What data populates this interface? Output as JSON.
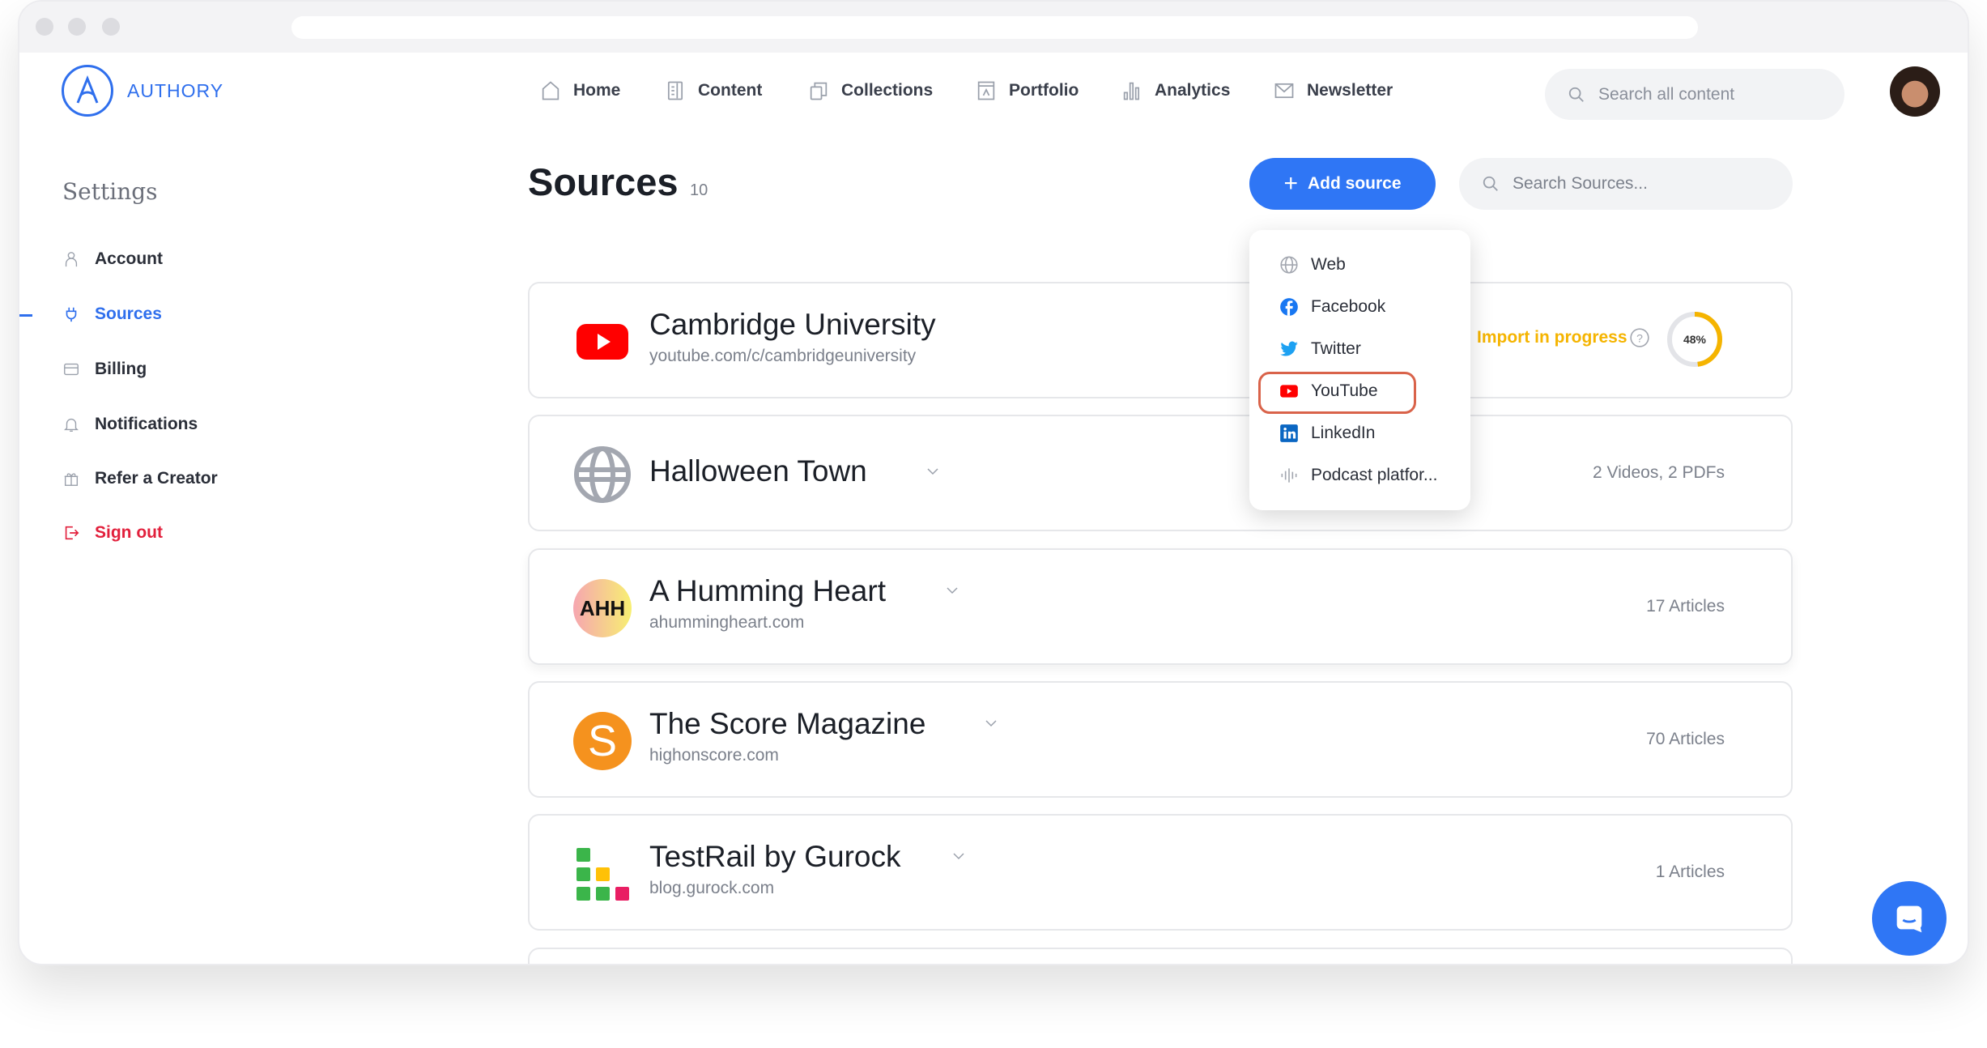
{
  "nav": {
    "brand": "AUTHORY",
    "items": [
      {
        "label": "Home",
        "icon": "home-icon"
      },
      {
        "label": "Content",
        "icon": "content-icon"
      },
      {
        "label": "Collections",
        "icon": "collections-icon"
      },
      {
        "label": "Portfolio",
        "icon": "portfolio-icon"
      },
      {
        "label": "Analytics",
        "icon": "analytics-icon"
      },
      {
        "label": "Newsletter",
        "icon": "newsletter-icon"
      }
    ],
    "search_placeholder": "Search all content"
  },
  "sidebar": {
    "heading": "Settings",
    "items": [
      {
        "label": "Account",
        "icon": "user-icon"
      },
      {
        "label": "Sources",
        "icon": "plug-icon",
        "active": true
      },
      {
        "label": "Billing",
        "icon": "card-icon"
      },
      {
        "label": "Notifications",
        "icon": "bell-icon"
      },
      {
        "label": "Refer a Creator",
        "icon": "gift-icon"
      },
      {
        "label": "Sign out",
        "icon": "sign-out-icon"
      }
    ]
  },
  "main": {
    "title": "Sources",
    "count": "10",
    "add_label": "Add source",
    "search_placeholder": "Search Sources...",
    "sources": [
      {
        "name": "Cambridge University",
        "url": "youtube.com/c/cambridgeuniversity",
        "status": "Import in progress",
        "progress": "48%"
      },
      {
        "name": "Halloween Town",
        "meta": "2 Videos, 2 PDFs"
      },
      {
        "name": "A Humming Heart",
        "url": "ahummingheart.com",
        "meta": "17 Articles",
        "logo_text": "AHH"
      },
      {
        "name": "The Score Magazine",
        "url": "highonscore.com",
        "meta": "70 Articles",
        "logo_text": "S"
      },
      {
        "name": "TestRail by Gurock",
        "url": "blog.gurock.com",
        "meta": "1 Articles"
      }
    ]
  },
  "add_menu": {
    "items": [
      "Web",
      "Facebook",
      "Twitter",
      "YouTube",
      "LinkedIn",
      "Podcast platfor..."
    ],
    "highlighted": "YouTube"
  },
  "colors": {
    "accent": "#2f76f5",
    "progress": "#f5b400",
    "signout": "#e2203c",
    "highlight": "#d9634a"
  }
}
